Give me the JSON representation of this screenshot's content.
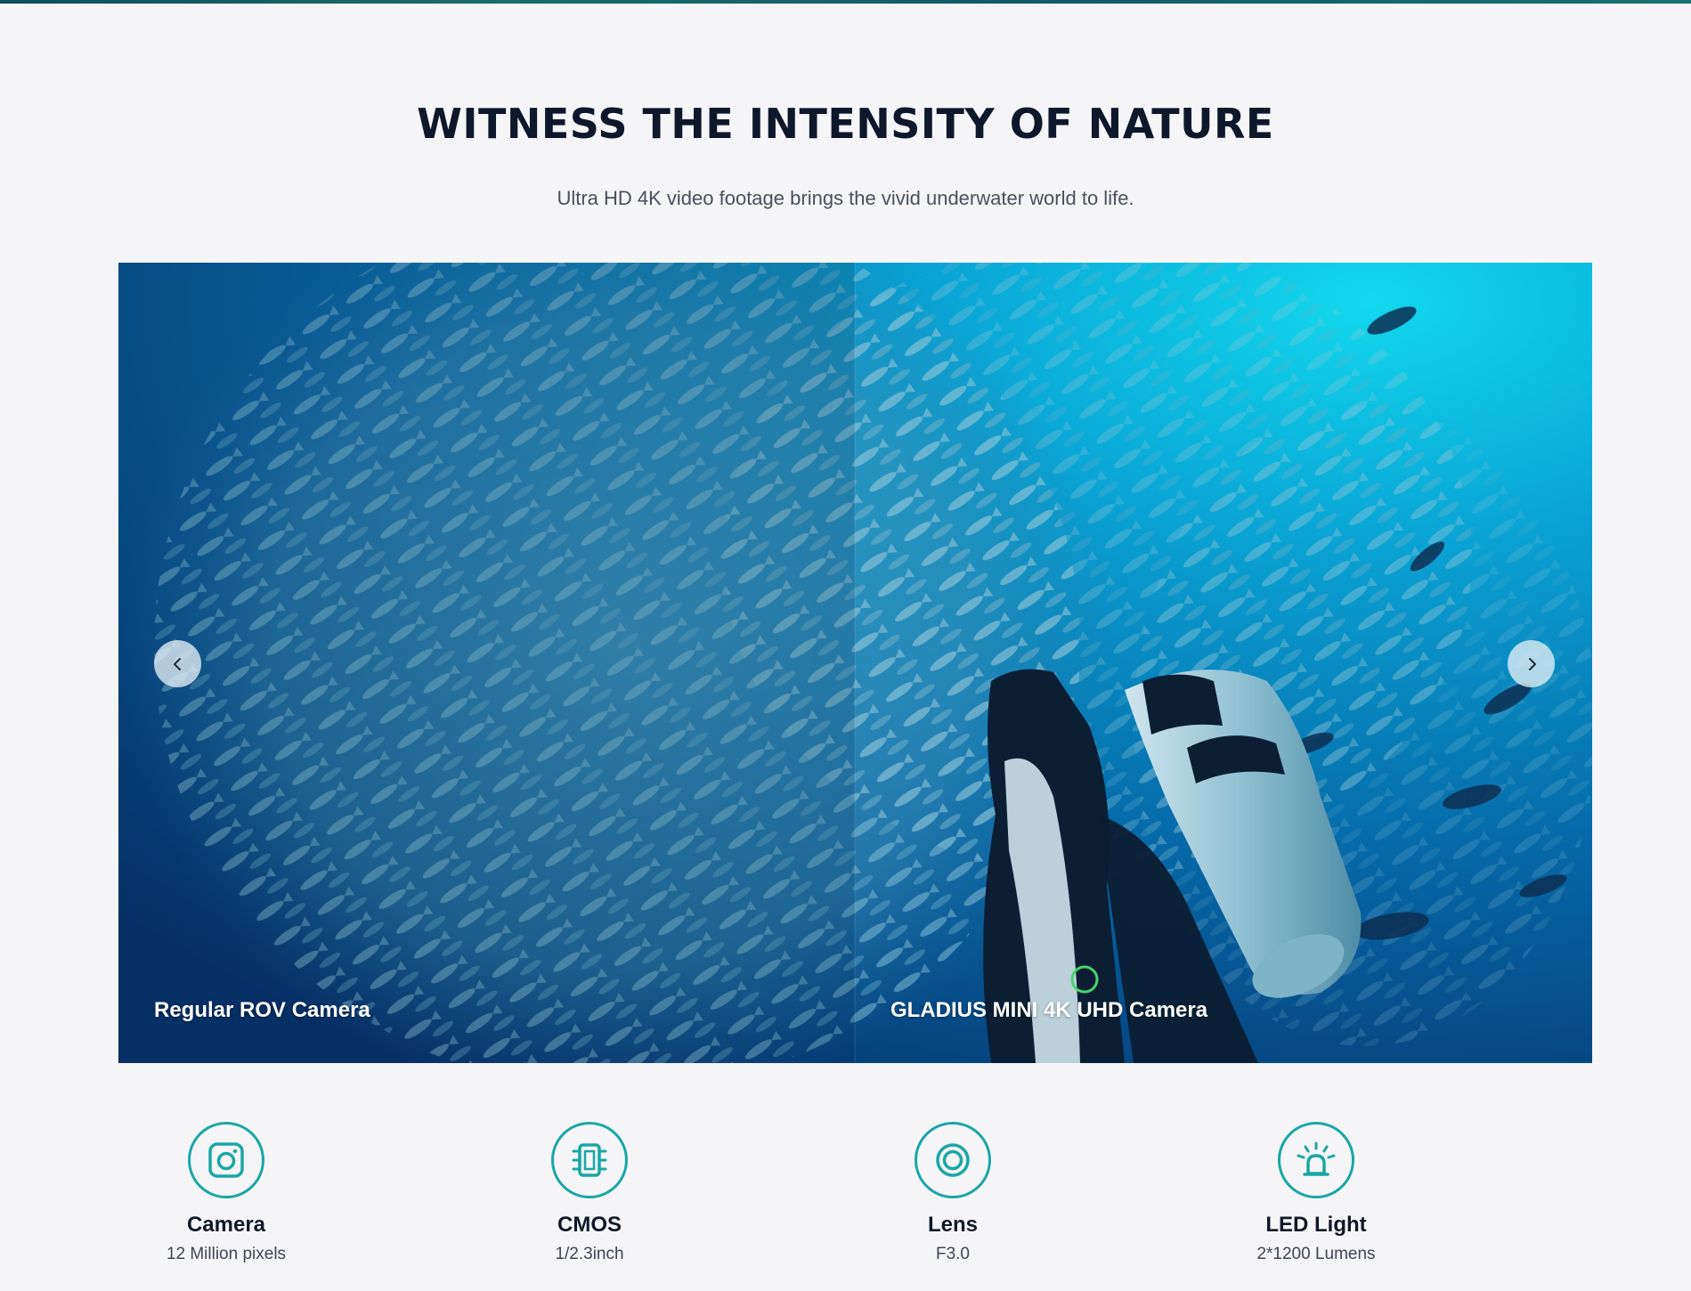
{
  "section": {
    "title": "WITNESS THE INTENSITY OF NATURE",
    "subtitle": "Ultra HD 4K video footage brings the vivid underwater world to life."
  },
  "comparison": {
    "left_caption": "Regular ROV Camera",
    "right_caption": "GLADIUS MINI 4K UHD Camera",
    "prev_icon": "chevron-left-icon",
    "next_icon": "chevron-right-icon"
  },
  "features": [
    {
      "icon": "camera-icon",
      "title": "Camera",
      "value": "12 Million pixels"
    },
    {
      "icon": "chip-icon",
      "title": "CMOS",
      "value": "1/2.3inch"
    },
    {
      "icon": "lens-icon",
      "title": "Lens",
      "value": "F3.0"
    },
    {
      "icon": "light-icon",
      "title": "LED Light",
      "value": "2*1200 Lumens"
    }
  ],
  "colors": {
    "accent": "#1aa6a6",
    "background": "#f5f5f7",
    "title": "#0f172a"
  }
}
